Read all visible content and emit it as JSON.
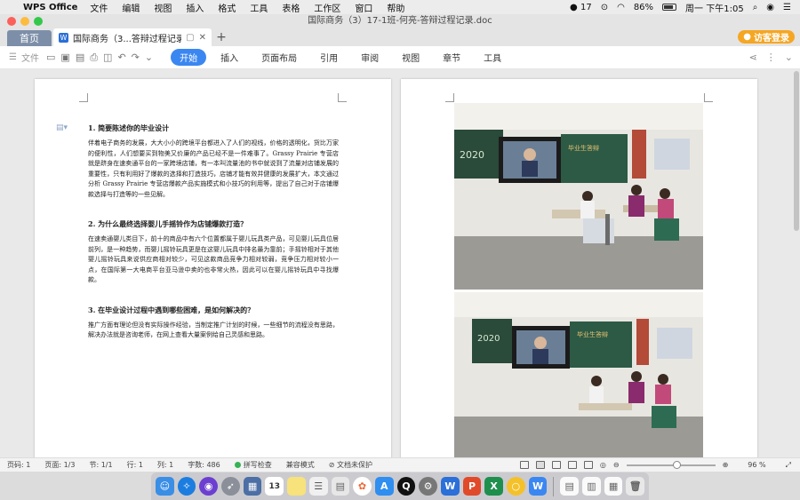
{
  "menubar": {
    "app_name": "WPS Office",
    "items": [
      "文件",
      "编辑",
      "视图",
      "插入",
      "格式",
      "工具",
      "表格",
      "工作区",
      "窗口",
      "帮助"
    ],
    "status_count": "17",
    "battery": "86%",
    "battery_level": 0.86,
    "clock": "周一 下午1:05"
  },
  "window": {
    "title": "国际商务（3）17-1班-何亮-答辩过程记录.doc",
    "home_tab": "首页",
    "doc_tab": "国际商务（3...答辩过程记录",
    "guest_login": "访客登录"
  },
  "ribbon": {
    "file_label": "文件",
    "tabs": [
      "开始",
      "插入",
      "页面布局",
      "引用",
      "审阅",
      "视图",
      "章节",
      "工具"
    ],
    "active_tab": "开始"
  },
  "document": {
    "sections": [
      {
        "heading": "1.  简要陈述你的毕业设计",
        "body": "伴着电子商务的发展，大大小小的跨境平台都进入了人们的视线，价格的透明化，货比万家的便利性，人们想要买到物美又价廉的产品已经不是一件难事了。Grassy Prairie 专营店就是跻身在速卖通平台的一家跨境店铺，有一本叫流量池的书中就说到了流量对店铺发展的重要性，只有利用好了爆款的选择和打造技巧，店铺才能有效并健康的发展扩大，本文通过分析 Grassy Prairie 专营店爆款产品实施模式和小技巧的利用等，提出了自己对于店铺爆款选择与打造等的一些见解。"
      },
      {
        "heading": "2.    为什么最终选择婴儿手摇铃作为店铺爆款打造？",
        "body": "在速卖通婴儿类目下，前十的商品中有六个位置都属于婴儿玩具类产品，可见婴儿玩具位居前列，是一种趋势，而婴儿摇铃玩具更是在这婴儿玩具中排名最为靠前；手摇铃相对于其他婴儿摇铃玩具来说供应商相对较少，可见这款商品竞争力相对较弱，竞争压力相对较小一点，在国际第一大电商平台亚马逊中卖的也非常火热，因此可以在婴儿摇铃玩具中寻找爆款。"
      },
      {
        "heading": "3.    在毕业设计过程中遇到哪些困难，是如何解决的？",
        "body": "推广方面有理论但没有实际操作经验，当制定推广计划的时候，一些细节的流程没有思路，解决办法就是咨询老师，在网上查看大量案例给自己灵感和思路。"
      }
    ],
    "photo_board_text": "2020",
    "photo_board_text_2": "毕业生答辩"
  },
  "statusbar": {
    "page_num": "页码: 1",
    "pages": "页面: 1/3",
    "section": "节: 1/1",
    "row": "行: 1",
    "col": "列: 1",
    "word_count": "字数: 486",
    "spell_check": "拼写检查",
    "compat_mode": "兼容模式",
    "unprotected": "文档未保护",
    "zoom": "96 %",
    "zoom_level": 0.96
  },
  "colors": {
    "accent": "#3b87f1",
    "guest": "#f5a623"
  }
}
